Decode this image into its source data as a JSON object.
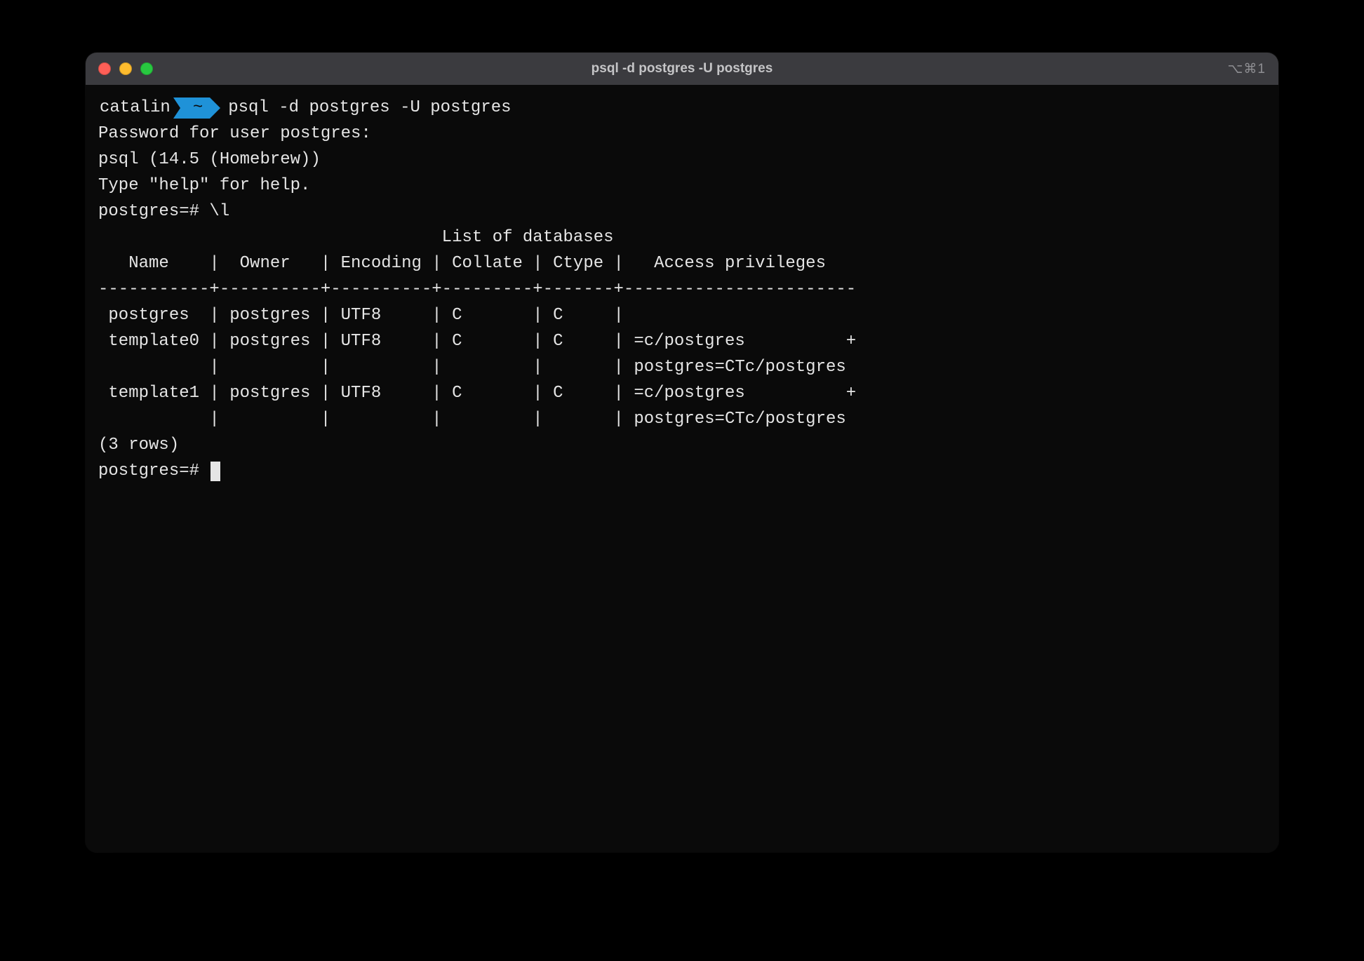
{
  "window": {
    "title": "psql -d postgres -U postgres",
    "shortcut": "⌥⌘1"
  },
  "prompt": {
    "user": "catalin",
    "dir": "~",
    "command": "psql -d postgres -U postgres"
  },
  "output": {
    "l1": "Password for user postgres:",
    "l2": "psql (14.5 (Homebrew))",
    "l3": "Type \"help\" for help.",
    "blank": "",
    "l4": "postgres=# \\l",
    "heading": "                                  List of databases",
    "hdr": "   Name    |  Owner   | Encoding | Collate | Ctype |   Access privileges",
    "sep": "-----------+----------+----------+---------+-------+-----------------------",
    "r1": " postgres  | postgres | UTF8     | C       | C     |",
    "r2": " template0 | postgres | UTF8     | C       | C     | =c/postgres          +",
    "r2b": "           |          |          |         |       | postgres=CTc/postgres",
    "r3": " template1 | postgres | UTF8     | C       | C     | =c/postgres          +",
    "r3b": "           |          |          |         |       | postgres=CTc/postgres",
    "rows": "(3 rows)"
  },
  "prompt2": "postgres=# "
}
